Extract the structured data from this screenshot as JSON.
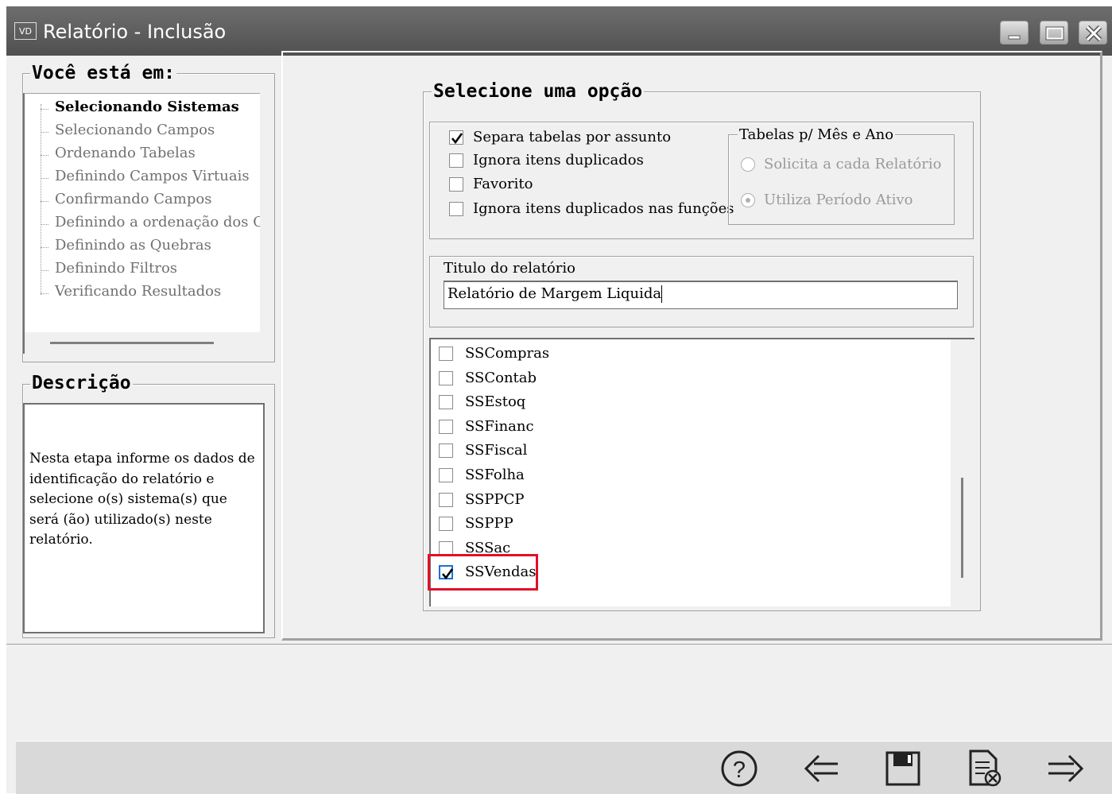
{
  "window": {
    "app_icon": "VD",
    "title": "Relatório - Inclusão"
  },
  "left": {
    "nav_title": "Você está em:",
    "steps": [
      {
        "label": "Selecionando Sistemas",
        "active": true
      },
      {
        "label": "Selecionando Campos",
        "active": false
      },
      {
        "label": "Ordenando Tabelas",
        "active": false
      },
      {
        "label": "Definindo Campos Virtuais",
        "active": false
      },
      {
        "label": "Confirmando Campos",
        "active": false
      },
      {
        "label": "Definindo a ordenação dos Can",
        "active": false
      },
      {
        "label": "Definindo as Quebras",
        "active": false
      },
      {
        "label": "Definindo Filtros",
        "active": false
      },
      {
        "label": "Verificando Resultados",
        "active": false
      }
    ],
    "desc_title": "Descrição",
    "desc_text": "Nesta etapa informe os dados de identificação do relatório e selecione o(s) sistema(s) que será (ão) utilizado(s) neste relatório."
  },
  "main": {
    "title": "Selecione uma opção",
    "options": [
      {
        "label": "Separa tabelas por assunto",
        "checked": true
      },
      {
        "label": "Ignora itens duplicados",
        "checked": false
      },
      {
        "label": "Favorito",
        "checked": false
      },
      {
        "label": "Ignora itens duplicados nas funções",
        "checked": false
      }
    ],
    "period_group": {
      "title": "Tabelas p/ Mês e Ano",
      "radios": [
        {
          "label": "Solicita a cada Relatório",
          "selected": false
        },
        {
          "label": "Utiliza Período Ativo",
          "selected": true
        }
      ]
    },
    "report_title_label": "Titulo do relatório",
    "report_title_value": "Relatório de Margem Liquida",
    "systems": [
      {
        "label": "SSCompras",
        "checked": false
      },
      {
        "label": "SSContab",
        "checked": false
      },
      {
        "label": "SSEstoq",
        "checked": false
      },
      {
        "label": "SSFinanc",
        "checked": false
      },
      {
        "label": "SSFiscal",
        "checked": false
      },
      {
        "label": "SSFolha",
        "checked": false
      },
      {
        "label": "SSPPCP",
        "checked": false
      },
      {
        "label": "SSPPP",
        "checked": false
      },
      {
        "label": "SSSac",
        "checked": false
      },
      {
        "label": "SSVendas",
        "checked": true
      }
    ]
  },
  "toolbar": [
    {
      "name": "help-icon"
    },
    {
      "name": "back-arrow-icon"
    },
    {
      "name": "save-icon"
    },
    {
      "name": "cancel-document-icon"
    },
    {
      "name": "forward-arrow-icon"
    }
  ],
  "colors": {
    "titlebar": "#5a5a5a",
    "highlight": "#e0102a",
    "window_bg": "#f0f0f0"
  }
}
